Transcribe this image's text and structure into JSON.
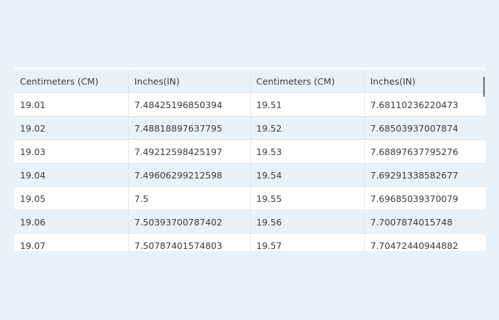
{
  "table": {
    "headers": [
      "Centimeters (CM)",
      "Inches(IN)",
      "Centimeters (CM)",
      "Inches(IN)"
    ],
    "rows": [
      [
        "19.01",
        "7.48425196850394",
        "19.51",
        "7.68110236220473"
      ],
      [
        "19.02",
        "7.48818897637795",
        "19.52",
        "7.68503937007874"
      ],
      [
        "19.03",
        "7.49212598425197",
        "19.53",
        "7.68897637795276"
      ],
      [
        "19.04",
        "7.49606299212598",
        "19.54",
        "7.69291338582677"
      ],
      [
        "19.05",
        "7.5",
        "19.55",
        "7.69685039370079"
      ],
      [
        "19.06",
        "7.50393700787402",
        "19.56",
        "7.7007874015748"
      ],
      [
        "19.07",
        "7.50787401574803",
        "19.57",
        "7.70472440944882"
      ]
    ]
  }
}
